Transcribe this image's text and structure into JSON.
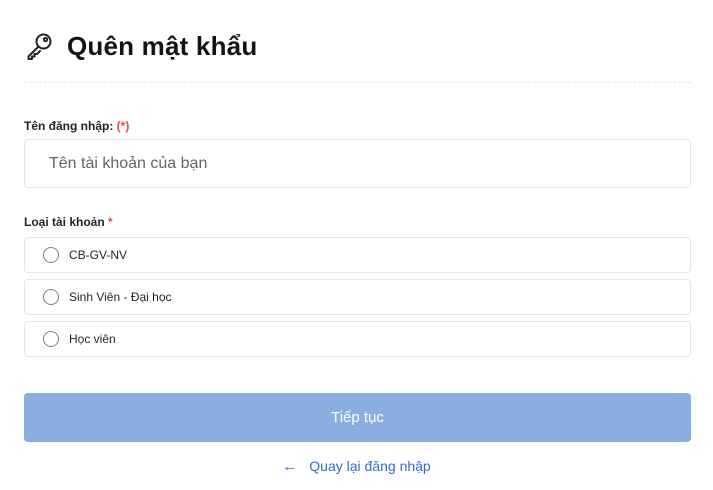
{
  "header": {
    "icon": "key-icon",
    "title": "Quên mật khẩu"
  },
  "username": {
    "label": "Tên đăng nhập:",
    "required_mark": "(*)",
    "placeholder": "Tên tài khoản của bạn",
    "value": ""
  },
  "account_type": {
    "label": "Loại tài khoản",
    "required_mark": "*",
    "options": [
      {
        "label": "CB-GV-NV",
        "selected": false
      },
      {
        "label": "Sinh Viên - Đại học",
        "selected": false
      },
      {
        "label": "Học viên",
        "selected": false
      }
    ]
  },
  "actions": {
    "submit_label": "Tiếp tục",
    "back_arrow": "←",
    "back_label": "Quay lại đăng nhập"
  },
  "colors": {
    "submit_bg": "#8aaee0",
    "link": "#2f6bd8",
    "required": "#e5484d"
  }
}
